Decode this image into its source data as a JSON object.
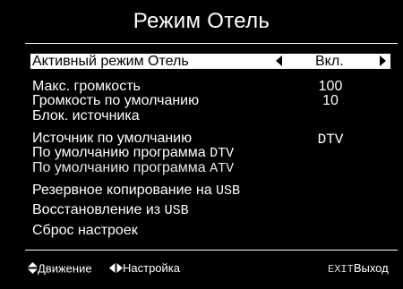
{
  "menu": {
    "title": "Режим Отель",
    "active_row": {
      "label": "Активный режим Отель",
      "value": "Вкл."
    },
    "items": [
      {
        "label": "Макс. громкость",
        "value": "100"
      },
      {
        "label": "Громкость по умолчанию",
        "value": "10"
      },
      {
        "label": "Блок. источника",
        "value": ""
      },
      {
        "label": "Источник по умолчанию",
        "value": "DTV"
      },
      {
        "label_text": "По умолчанию программа ",
        "label_code": "DTV",
        "value": ""
      },
      {
        "label_text": "По умолчанию программа ",
        "label_code": "ATV",
        "value": ""
      },
      {
        "label_text": "Резервное копирование на ",
        "label_code": "USB",
        "value": ""
      },
      {
        "label_text": "Восстановление из ",
        "label_code": "USB",
        "value": ""
      },
      {
        "label": "Сброс настроек",
        "value": ""
      }
    ]
  },
  "footer": {
    "move_label": "Движение",
    "adjust_label": "Настройка",
    "exit_key": "EXIT",
    "exit_label": "Выход"
  }
}
